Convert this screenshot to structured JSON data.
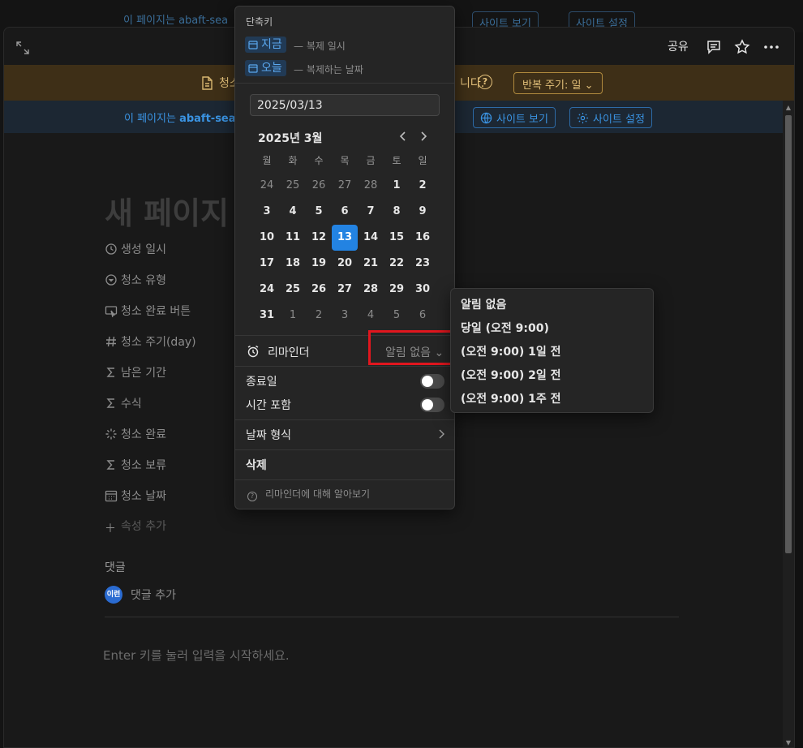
{
  "background": {
    "banner_text": "이 페이지는 abaft-sea",
    "view_site_label": "사이트 보기",
    "site_settings_label": "사이트 설정"
  },
  "topbar": {
    "share_label": "공유",
    "icons": [
      "expand-icon",
      "comment-icon",
      "star-icon",
      "more-icon"
    ]
  },
  "warning_banner": {
    "text": "청소",
    "text_tail": "니다.",
    "repeat_label": "반복 주기: 일",
    "color": "#3e2f17"
  },
  "site_banner": {
    "text_prefix": "이 페이지는 ",
    "site_name": "abaft-sea",
    "view_site_label": "사이트 보기",
    "site_settings_label": "사이트 설정"
  },
  "page": {
    "title": "새 페이지",
    "properties": [
      {
        "icon": "clock-icon",
        "label": "생성 일시"
      },
      {
        "icon": "select-icon",
        "label": "청소 유형"
      },
      {
        "icon": "button-icon",
        "label": "청소 완료 버튼"
      },
      {
        "icon": "number-icon",
        "label": "청소 주기(day)"
      },
      {
        "icon": "sigma-icon",
        "label": "남은 기간"
      },
      {
        "icon": "sigma-icon",
        "label": "수식"
      },
      {
        "icon": "loading-icon",
        "label": "청소 완료"
      },
      {
        "icon": "sigma-icon",
        "label": "청소 보류"
      },
      {
        "icon": "calendar-icon",
        "label": "청소 날짜"
      }
    ],
    "add_property_label": "속성 추가",
    "comments_heading": "댓글",
    "avatar_text": "이런",
    "add_comment_label": "댓글 추가",
    "editor_hint": "Enter 키를 눌러 입력을 시작하세요."
  },
  "date_popup": {
    "shortcuts_heading": "단축키",
    "shortcuts": [
      {
        "label": "지금",
        "desc": "— 복제 일시"
      },
      {
        "label": "오늘",
        "desc": "— 복제하는 날짜"
      }
    ],
    "date_value": "2025/03/13",
    "month_label": "2025년 3월",
    "weekdays": [
      "월",
      "화",
      "수",
      "목",
      "금",
      "토",
      "일"
    ],
    "weeks": [
      [
        "24",
        "25",
        "26",
        "27",
        "28",
        "1",
        "2"
      ],
      [
        "3",
        "4",
        "5",
        "6",
        "7",
        "8",
        "9"
      ],
      [
        "10",
        "11",
        "12",
        "13",
        "14",
        "15",
        "16"
      ],
      [
        "17",
        "18",
        "19",
        "20",
        "21",
        "22",
        "23"
      ],
      [
        "24",
        "25",
        "26",
        "27",
        "28",
        "29",
        "30"
      ],
      [
        "31",
        "1",
        "2",
        "3",
        "4",
        "5",
        "6"
      ]
    ],
    "selected_day": "13",
    "selected_color": "#2383e2",
    "reminder_label": "리마인더",
    "reminder_value": "알림 없음",
    "end_date_label": "종료일",
    "include_time_label": "시간 포함",
    "end_date_on": false,
    "include_time_on": false,
    "date_format_label": "날짜 형식",
    "delete_label": "삭제",
    "learn_label": "리마인더에 대해 알아보기"
  },
  "reminder_menu": {
    "options": [
      "알림 없음",
      "당일 (오전 9:00)",
      "(오전 9:00) 1일 전",
      "(오전 9:00) 2일 전",
      "(오전 9:00) 1주 전"
    ]
  },
  "highlight_color": "#e1161e"
}
